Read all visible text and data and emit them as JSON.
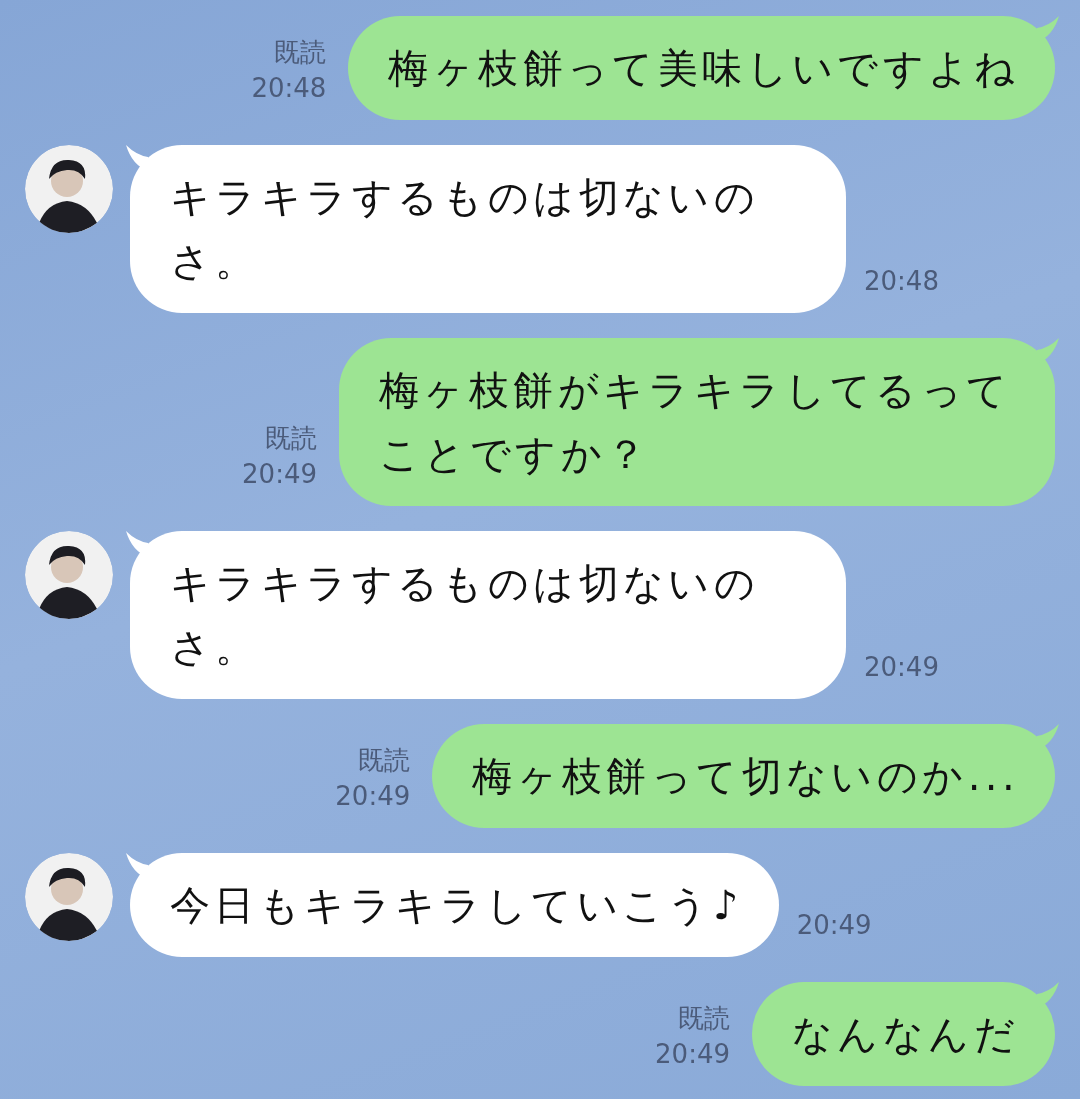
{
  "messages": [
    {
      "kind": "sent",
      "read": "既読",
      "time": "20:48",
      "text": "梅ヶ枝餅って美味しいですよね"
    },
    {
      "kind": "received",
      "text": "キラキラするものは切ないのさ。",
      "time": "20:48"
    },
    {
      "kind": "sent",
      "read": "既読",
      "time": "20:49",
      "text": "梅ヶ枝餅がキラキラしてるってことですか？"
    },
    {
      "kind": "received",
      "text": "キラキラするものは切ないのさ。",
      "time": "20:49"
    },
    {
      "kind": "sent",
      "read": "既読",
      "time": "20:49",
      "text": "梅ヶ枝餅って切ないのか..."
    },
    {
      "kind": "received",
      "text": "今日もキラキラしていこう♪",
      "time": "20:49"
    },
    {
      "kind": "sent",
      "read": "既読",
      "time": "20:49",
      "text": "なんなんだ"
    }
  ]
}
